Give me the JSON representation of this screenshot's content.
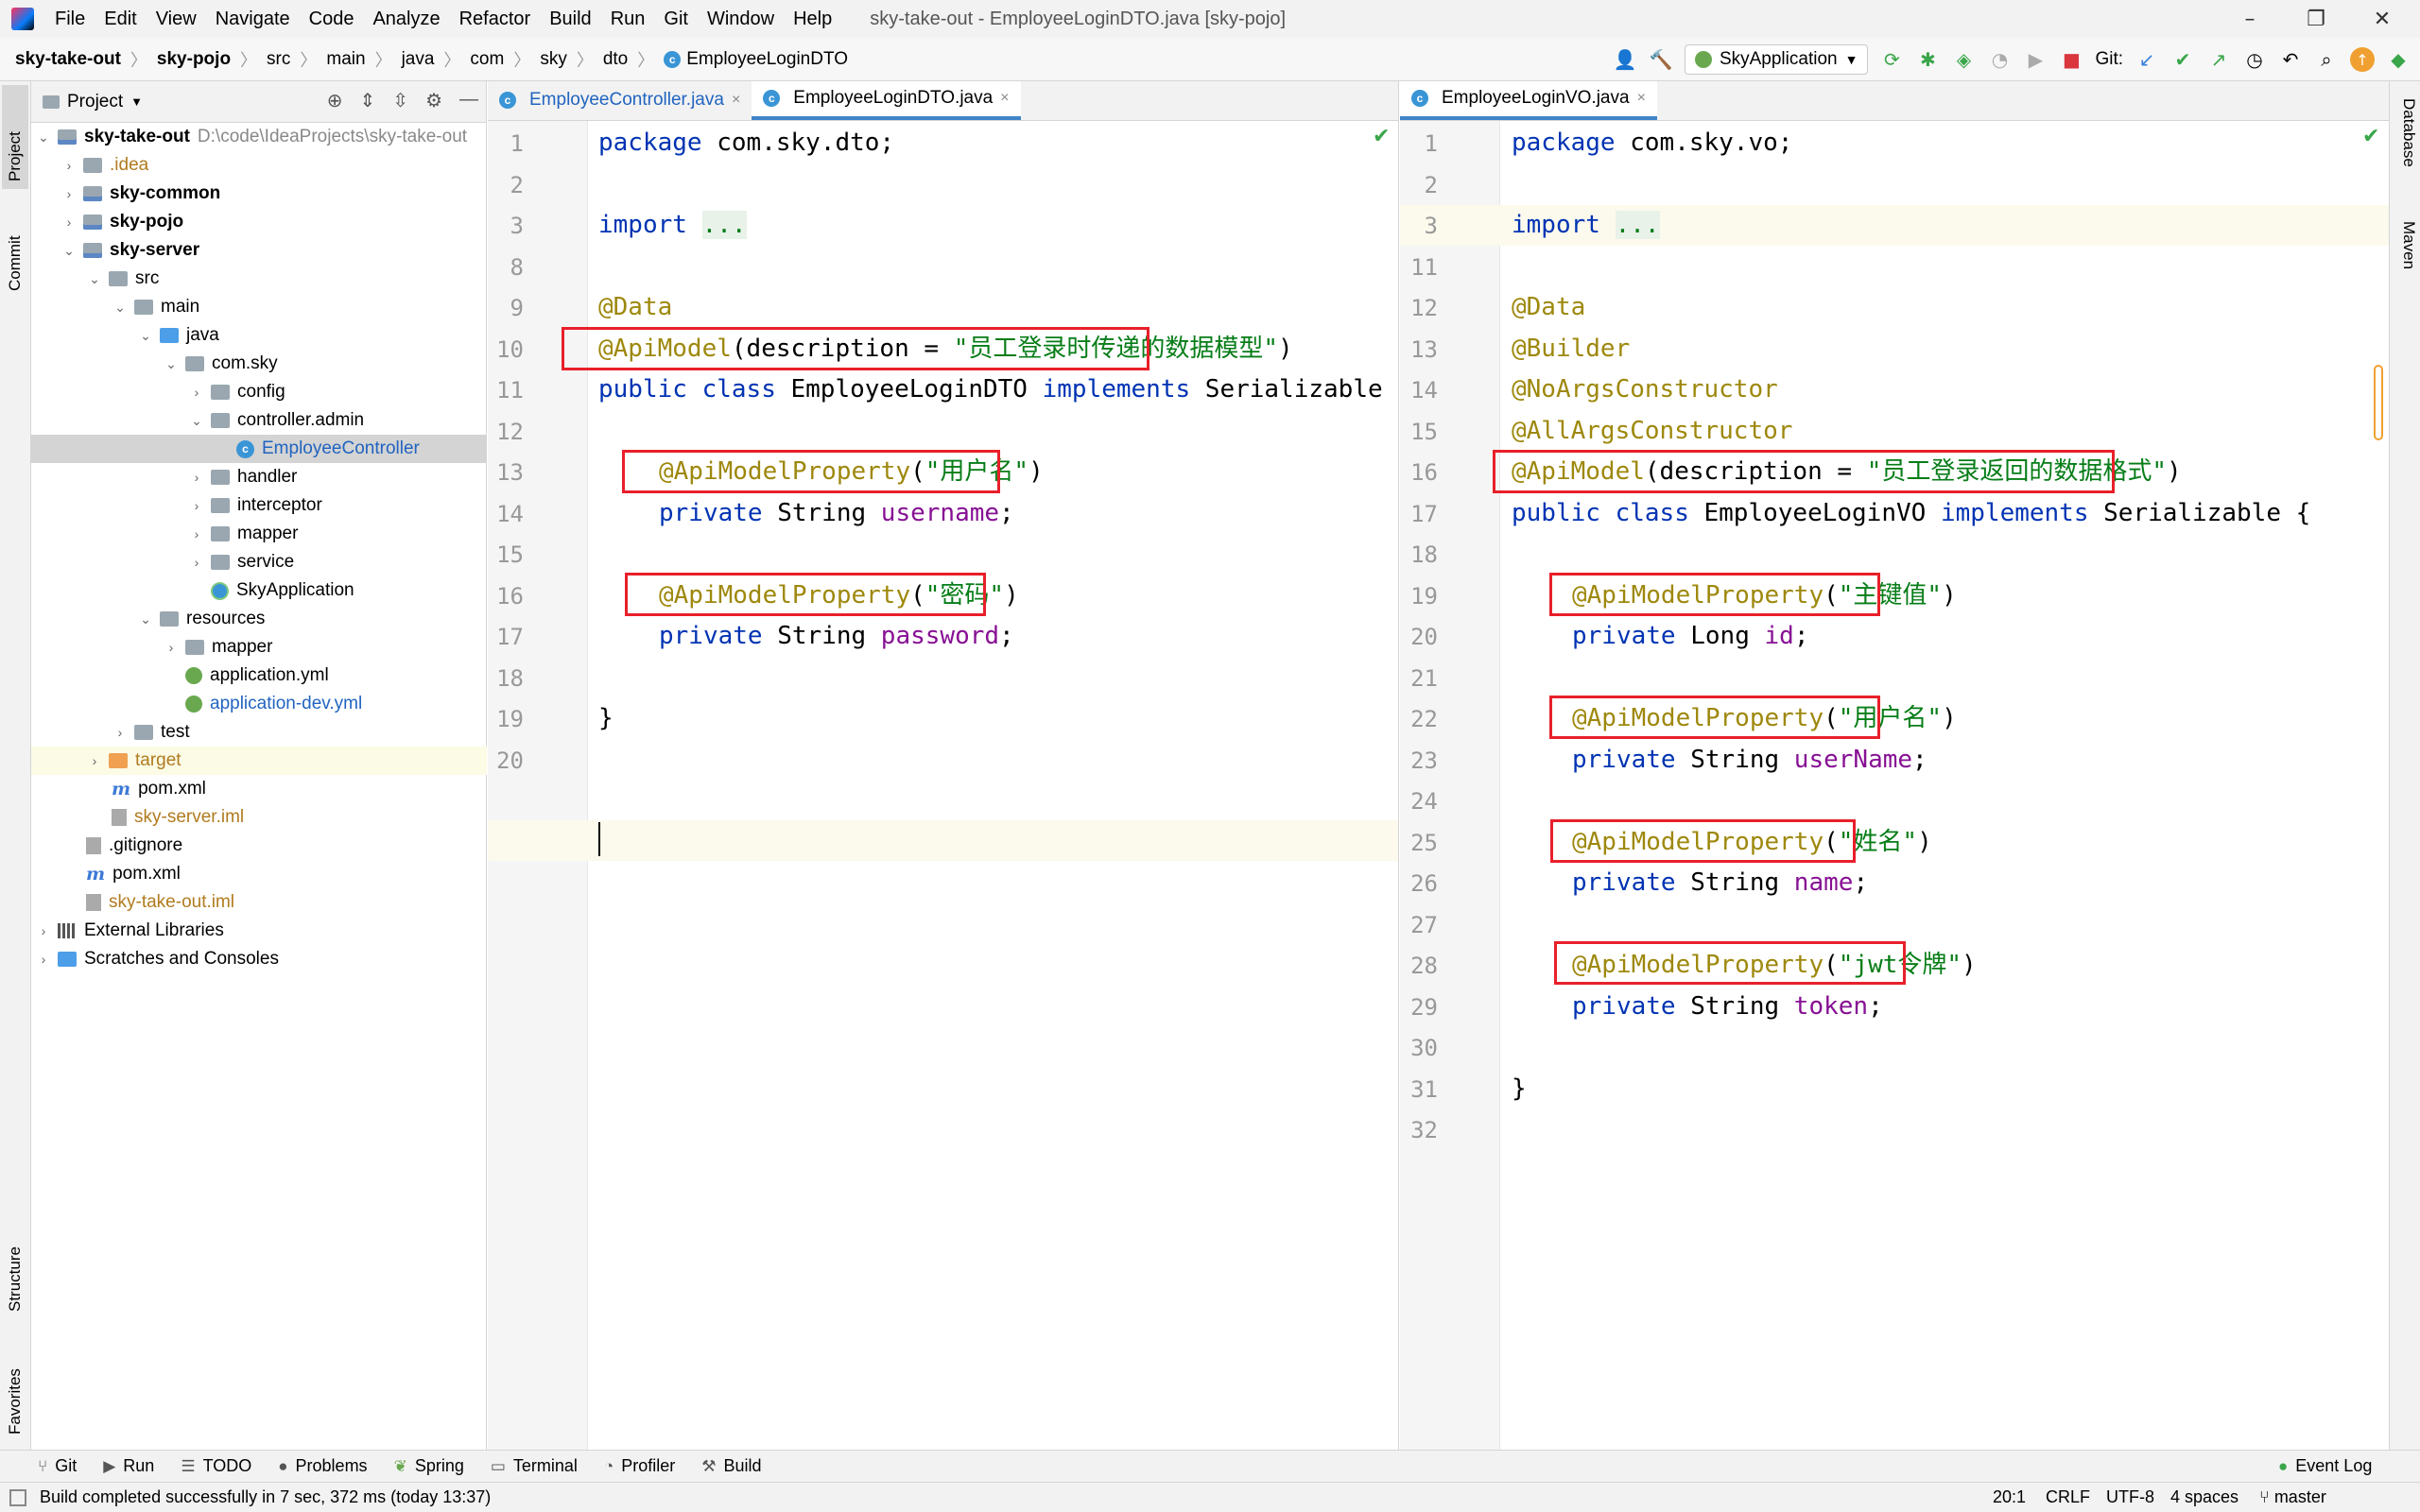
{
  "window": {
    "title": "sky-take-out - EmployeeLoginDTO.java [sky-pojo]",
    "menu": [
      "File",
      "Edit",
      "View",
      "Navigate",
      "Code",
      "Analyze",
      "Refactor",
      "Build",
      "Run",
      "Git",
      "Window",
      "Help"
    ],
    "minimize": "–",
    "maximize": "❐",
    "close": "✕"
  },
  "breadcrumb": {
    "items": [
      "sky-take-out",
      "sky-pojo",
      "src",
      "main",
      "java",
      "com",
      "sky",
      "dto",
      "EmployeeLoginDTO"
    ]
  },
  "toolbar": {
    "run_config": "SkyApplication",
    "git_label": "Git:"
  },
  "left_stripe": {
    "project": "Project",
    "commit": "Commit",
    "structure": "Structure",
    "favorites": "Favorites"
  },
  "right_stripe": {
    "database": "Database",
    "maven": "Maven"
  },
  "project_panel": {
    "title": "Project",
    "tree": [
      {
        "label": "sky-take-out",
        "extra": "D:\\code\\IdeaProjects\\sky-take-out"
      },
      {
        "label": ".idea"
      },
      {
        "label": "sky-common"
      },
      {
        "label": "sky-pojo"
      },
      {
        "label": "sky-server"
      },
      {
        "label": "src"
      },
      {
        "label": "main"
      },
      {
        "label": "java"
      },
      {
        "label": "com.sky"
      },
      {
        "label": "config"
      },
      {
        "label": "controller.admin"
      },
      {
        "label": "EmployeeController"
      },
      {
        "label": "handler"
      },
      {
        "label": "interceptor"
      },
      {
        "label": "mapper"
      },
      {
        "label": "service"
      },
      {
        "label": "SkyApplication"
      },
      {
        "label": "resources"
      },
      {
        "label": "mapper"
      },
      {
        "label": "application.yml"
      },
      {
        "label": "application-dev.yml"
      },
      {
        "label": "test"
      },
      {
        "label": "target"
      },
      {
        "label": "pom.xml"
      },
      {
        "label": "sky-server.iml"
      },
      {
        "label": ".gitignore"
      },
      {
        "label": "pom.xml"
      },
      {
        "label": "sky-take-out.iml"
      },
      {
        "label": "External Libraries"
      },
      {
        "label": "Scratches and Consoles"
      }
    ]
  },
  "left_editor": {
    "tabs": [
      {
        "label": "EmployeeController.java",
        "close": "×"
      },
      {
        "label": "EmployeeLoginDTO.java",
        "close": "×"
      }
    ],
    "line_numbers": [
      "1",
      "2",
      "3",
      "8",
      "9",
      "10",
      "11",
      "12",
      "13",
      "14",
      "15",
      "16",
      "17",
      "18",
      "19",
      "20"
    ],
    "lines": {
      "package_kw": "package",
      "package_name": " com.sky.dto;",
      "import_kw": "import",
      "import_fold": "...",
      "data": "@Data",
      "apimodel": "@ApiModel",
      "apimodel_args_a": "(description = ",
      "apimodel_str": "\"员工登录时传递的数据模型\"",
      "apimodel_args_b": ")",
      "cls_public": "public",
      "cls_class": " class",
      "cls_name": " EmployeeLoginDTO",
      "cls_impl": " implements",
      "cls_iface": " Serializable",
      "p1_ann": "@ApiModelProperty",
      "p1_str": "\"用户名\"",
      "f1_private": "private",
      "f1_type": " String",
      "f1_name": " username",
      "semi": ";",
      "p2_ann": "@ApiModelProperty",
      "p2_str": "\"密码\"",
      "f2_private": "private",
      "f2_type": " String",
      "f2_name": " password",
      "close_brace": "}",
      "open_paren": "(",
      "close_paren": ")"
    }
  },
  "right_editor": {
    "tabs": [
      {
        "label": "EmployeeLoginVO.java",
        "close": "×"
      }
    ],
    "line_numbers": [
      "1",
      "2",
      "3",
      "11",
      "12",
      "13",
      "14",
      "15",
      "16",
      "17",
      "18",
      "19",
      "20",
      "21",
      "22",
      "23",
      "24",
      "25",
      "26",
      "27",
      "28",
      "29",
      "30",
      "31",
      "32"
    ],
    "lines": {
      "package_kw": "package",
      "package_name": " com.sky.vo;",
      "import_kw": "import",
      "import_fold": "...",
      "data": "@Data",
      "builder": "@Builder",
      "noargs": "@NoArgsConstructor",
      "allargs": "@AllArgsConstructor",
      "apimodel": "@ApiModel",
      "apimodel_args_a": "(description = ",
      "apimodel_str": "\"员工登录返回的数据格式\"",
      "apimodel_args_b": ")",
      "cls_public": "public",
      "cls_class": " class",
      "cls_name": " EmployeeLoginVO",
      "cls_impl": " implements",
      "cls_iface": " Serializable {",
      "p1_ann": "@ApiModelProperty",
      "p1_str": "\"主键值\"",
      "f1_private": "private",
      "f1_type": " Long",
      "f1_name": " id",
      "p2_ann": "@ApiModelProperty",
      "p2_str": "\"用户名\"",
      "f2_private": "private",
      "f2_type": " String",
      "f2_name": " userName",
      "p3_ann": "@ApiModelProperty",
      "p3_str": "\"姓名\"",
      "f3_private": "private",
      "f3_type": " String",
      "f3_name": " name",
      "p4_ann": "@ApiModelProperty",
      "p4_str": "\"jwt令牌\"",
      "f4_private": "private",
      "f4_type": " String",
      "f4_name": " token",
      "semi": ";",
      "close_brace": "}",
      "open_paren": "(",
      "close_paren": ")"
    }
  },
  "bottom_tools": [
    "Git",
    "Run",
    "TODO",
    "Problems",
    "Spring",
    "Terminal",
    "Profiler",
    "Build",
    "Event Log"
  ],
  "status": {
    "message": "Build completed successfully in 7 sec, 372 ms (today 13:37)",
    "position": "20:1",
    "line_sep": "CRLF",
    "encoding": "UTF-8",
    "indent": "4 spaces",
    "branch": "master"
  },
  "colors": {
    "keyword": "#0033b3",
    "annotation": "#9e880d",
    "string": "#067d17",
    "field": "#871094",
    "highlight_box": "#e8202a"
  }
}
